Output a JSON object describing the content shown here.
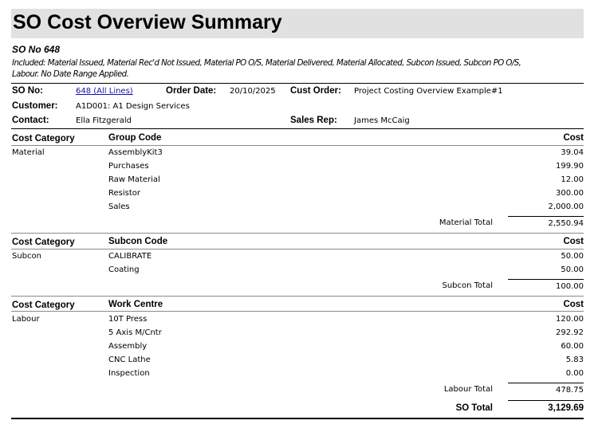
{
  "title": "SO Cost Overview Summary",
  "so_heading": "SO No 648",
  "included_line1": "Included: Material Issued, Material Rec'd Not Issued, Material PO O/S, Material Delivered, Material Allocated, Subcon Issued, Subcon PO O/S,",
  "included_line2": "Labour.  No Date Range Applied.",
  "header": {
    "so_no_label": "SO No:",
    "so_no_value": "648 (All Lines)",
    "order_date_label": "Order Date:",
    "order_date_value": "20/10/2025",
    "cust_order_label": "Cust Order:",
    "cust_order_value": "Project Costing Overview Example#1",
    "customer_label": "Customer:",
    "customer_value": "A1D001: A1 Design Services",
    "contact_label": "Contact:",
    "contact_value": "Ella Fitzgerald",
    "sales_rep_label": "Sales Rep:",
    "sales_rep_value": "James McCaig"
  },
  "sections": [
    {
      "cat_header": "Cost Category",
      "code_header": "Group Code",
      "cost_header": "Cost",
      "category": "Material",
      "rows": [
        {
          "code": "AssemblyKit3",
          "cost": "39.04"
        },
        {
          "code": "Purchases",
          "cost": "199.90"
        },
        {
          "code": "Raw Material",
          "cost": "12.00"
        },
        {
          "code": "Resistor",
          "cost": "300.00"
        },
        {
          "code": "Sales",
          "cost": "2,000.00"
        }
      ],
      "total_label": "Material Total",
      "total_value": "2,550.94"
    },
    {
      "cat_header": "Cost Category",
      "code_header": "Subcon Code",
      "cost_header": "Cost",
      "category": "Subcon",
      "rows": [
        {
          "code": "CALIBRATE",
          "cost": "50.00"
        },
        {
          "code": "Coating",
          "cost": "50.00"
        }
      ],
      "total_label": "Subcon Total",
      "total_value": "100.00"
    },
    {
      "cat_header": "Cost Category",
      "code_header": "Work Centre",
      "cost_header": "Cost",
      "category": "Labour",
      "rows": [
        {
          "code": "10T Press",
          "cost": "120.00"
        },
        {
          "code": "5 Axis M/Cntr",
          "cost": "292.92"
        },
        {
          "code": "Assembly",
          "cost": "60.00"
        },
        {
          "code": "CNC Lathe",
          "cost": "5.83"
        },
        {
          "code": "Inspection",
          "cost": "0.00"
        }
      ],
      "total_label": "Labour Total",
      "total_value": "478.75"
    }
  ],
  "so_total_label": "SO Total",
  "so_total_value": "3,129.69"
}
